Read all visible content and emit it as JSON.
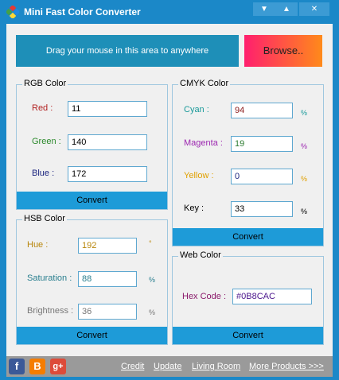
{
  "window": {
    "title": "Mini Fast Color Converter"
  },
  "titlebar_buttons": {
    "minimize": "▼",
    "maximize": "▲",
    "close": "✕"
  },
  "banner": {
    "drag_text": "Drag your mouse in this area to anywhere",
    "browse_label": "Browse.."
  },
  "rgb": {
    "title": "RGB Color",
    "red_label": "Red :",
    "red": "11",
    "green_label": "Green :",
    "green": "140",
    "blue_label": "Blue :",
    "blue": "172",
    "convert": "Convert"
  },
  "cmyk": {
    "title": "CMYK Color",
    "cyan_label": "Cyan :",
    "cyan": "94",
    "magenta_label": "Magenta :",
    "magenta": "19",
    "yellow_label": "Yellow :",
    "yellow": "0",
    "key_label": "Key :",
    "key": "33",
    "unit": "%",
    "convert": "Convert"
  },
  "hsb": {
    "title": "HSB Color",
    "hue_label": "Hue :",
    "hue": "192",
    "hue_unit": "°",
    "saturation_label": "Saturation :",
    "saturation": "88",
    "brightness_label": "Brightness :",
    "brightness": "36",
    "unit": "%",
    "convert": "Convert"
  },
  "web": {
    "title": "Web Color",
    "hex_label": "Hex Code :",
    "hex": "#0B8CAC",
    "convert": "Convert"
  },
  "footer": {
    "facebook": "f",
    "blogger": "B",
    "google_plus": "g+",
    "links": [
      "Credit",
      "Update",
      "Living Room",
      "More Products >>>"
    ]
  },
  "colors": {
    "accent": "#1b88c8",
    "red_label": "#b22222",
    "green_label": "#2e8b2e",
    "blue_label": "#1a237e",
    "cyan_label": "#1a9a9a",
    "magenta_label": "#9c27b0",
    "yellow_label": "#e0a000"
  }
}
